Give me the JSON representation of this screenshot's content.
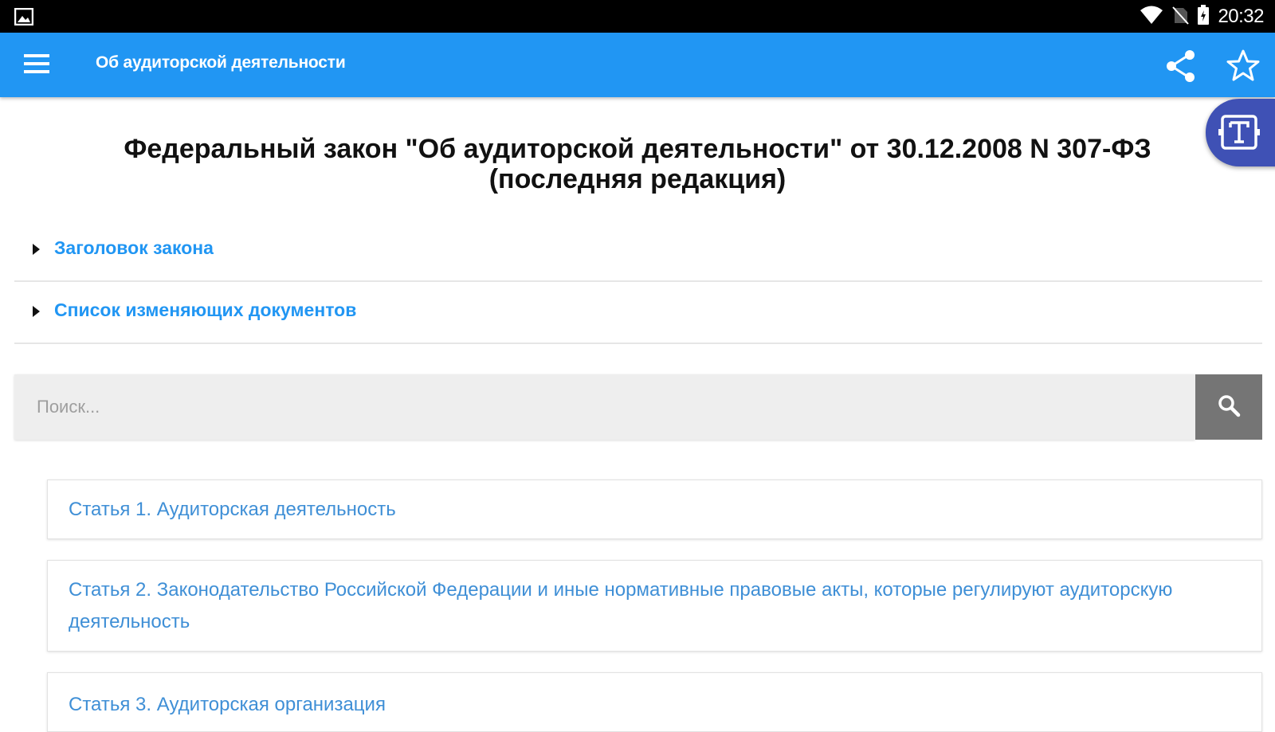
{
  "status_bar": {
    "time": "20:32",
    "icons": [
      "image-icon",
      "wifi-icon",
      "no-sim-icon",
      "battery-icon"
    ]
  },
  "app_bar": {
    "title": "Об аудиторской деятельности",
    "icons": [
      "menu-icon",
      "share-icon",
      "star-icon"
    ],
    "color": "#2196F3"
  },
  "fab": {
    "icon": "text-size-icon",
    "color": "#3F51B5"
  },
  "document": {
    "title_line1": "Федеральный закон \"Об аудиторской деятельности\" от 30.12.2008 N 307-ФЗ",
    "title_line2": "(последняя редакция)"
  },
  "expanders": [
    {
      "label": "Заголовок закона"
    },
    {
      "label": "Список изменяющих документов"
    }
  ],
  "search": {
    "placeholder": "Поиск...",
    "value": ""
  },
  "articles": [
    {
      "text": "Статья 1. Аудиторская деятельность"
    },
    {
      "text": "Статья 2. Законодательство Российской Федерации и иные нормативные правовые акты, которые регулируют аудиторскую деятельность"
    },
    {
      "text": "Статья 3. Аудиторская организация"
    }
  ]
}
